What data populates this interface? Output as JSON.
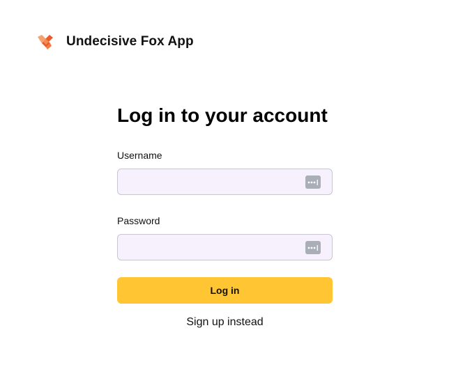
{
  "header": {
    "logo_icon": "fox-logo-icon",
    "app_title": "Undecisive Fox App"
  },
  "login_form": {
    "title": "Log in to your account",
    "username": {
      "label": "Username",
      "value": "",
      "placeholder": "",
      "icon": "password-manager-icon"
    },
    "password": {
      "label": "Password",
      "value": "",
      "placeholder": "",
      "icon": "password-manager-icon"
    },
    "submit_label": "Log in",
    "signup_link": "Sign up instead"
  },
  "colors": {
    "accent_button": "#ffc532",
    "input_background": "#f6f1fd",
    "input_border": "#c9c6d3",
    "logo_primary": "#ef5a2b",
    "logo_secondary": "#f7a070"
  }
}
